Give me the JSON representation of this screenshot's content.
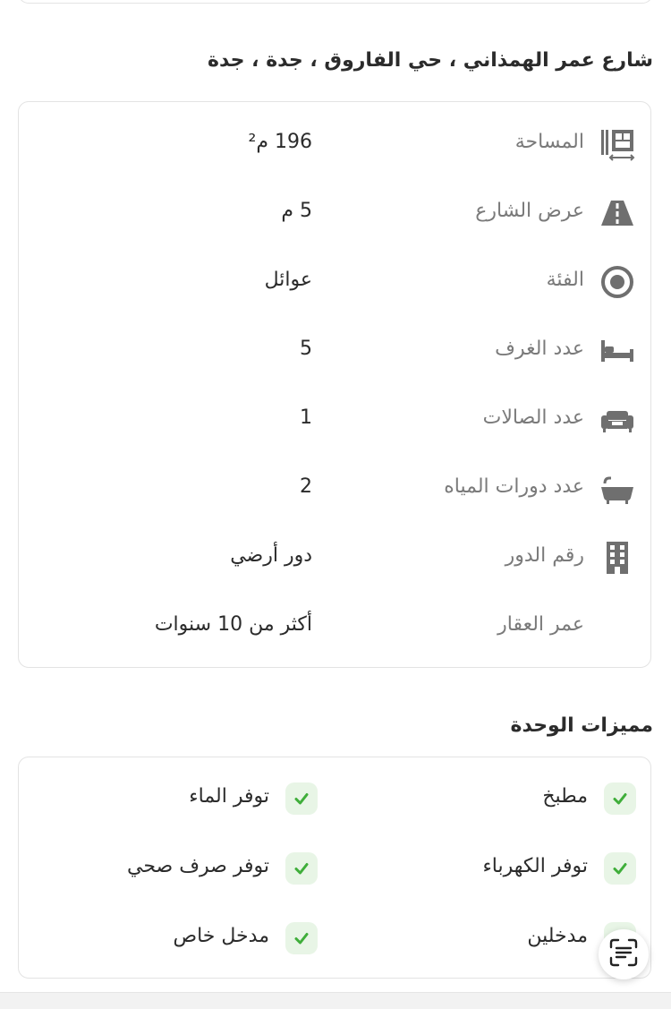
{
  "address": "شارع عمر الهمذاني ، حي الفاروق ، جدة ، جدة",
  "details": [
    {
      "icon": "area-measure-icon",
      "label": "المساحة",
      "value": "196 م²"
    },
    {
      "icon": "road-icon",
      "label": "عرض الشارع",
      "value": "5 م"
    },
    {
      "icon": "target-circle-icon",
      "label": "الفئة",
      "value": "عوائل"
    },
    {
      "icon": "bed-icon",
      "label": "عدد الغرف",
      "value": "5"
    },
    {
      "icon": "sofa-icon",
      "label": "عدد الصالات",
      "value": "1"
    },
    {
      "icon": "bathtub-icon",
      "label": "عدد دورات المياه",
      "value": "2"
    },
    {
      "icon": "building-icon",
      "label": "رقم الدور",
      "value": "دور أرضي"
    },
    {
      "icon": "",
      "label": "عمر العقار",
      "value": "أكثر من 10 سنوات"
    }
  ],
  "features_title": "مميزات الوحدة",
  "features": [
    {
      "label": "مطبخ"
    },
    {
      "label": "توفر الماء"
    },
    {
      "label": "توفر الكهرباء"
    },
    {
      "label": "توفر صرف صحي"
    },
    {
      "label": "مدخلين"
    },
    {
      "label": "مدخل خاص"
    }
  ],
  "colors": {
    "check_bg": "#e8f5e6",
    "check_mark": "#3fae3a",
    "icon_gray": "#6f6f6f"
  },
  "icons": {
    "check": "check-icon",
    "scan": "scan-text-icon"
  }
}
